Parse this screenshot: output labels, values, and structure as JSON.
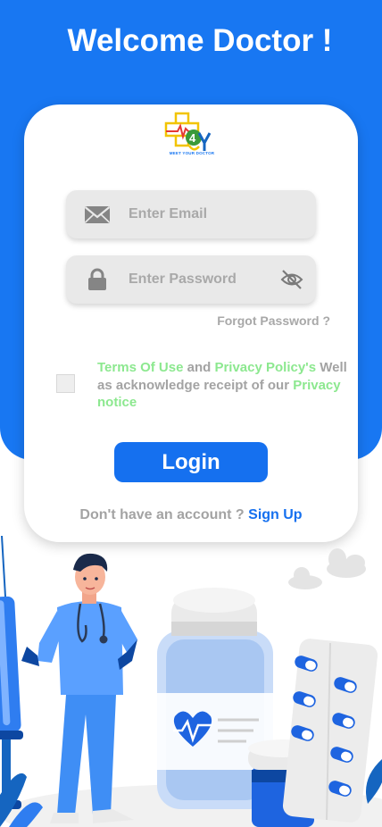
{
  "header": {
    "title": "Welcome Doctor !"
  },
  "logo": {
    "caption": "MEET YOUR DOCTOR"
  },
  "form": {
    "email_placeholder": "Enter Email",
    "password_placeholder": "Enter Password",
    "forgot_password": "Forgot Password ?",
    "terms": {
      "terms_link": "Terms Of Use",
      "and": " and ",
      "privacy_link": "Privacy Policy's",
      "acknowledge": " Well as acknowledge receipt of our ",
      "notice_link": "Privacy notice"
    },
    "login_label": "Login",
    "no_account": "Don't have an account ? ",
    "signup_label": "Sign Up"
  },
  "icons": {
    "email": "mail-icon",
    "password": "lock-icon",
    "visibility": "eye-slash-icon"
  },
  "colors": {
    "primary": "#1877f2",
    "link_green": "#8ce88f",
    "muted_text": "#a3a3a3"
  }
}
